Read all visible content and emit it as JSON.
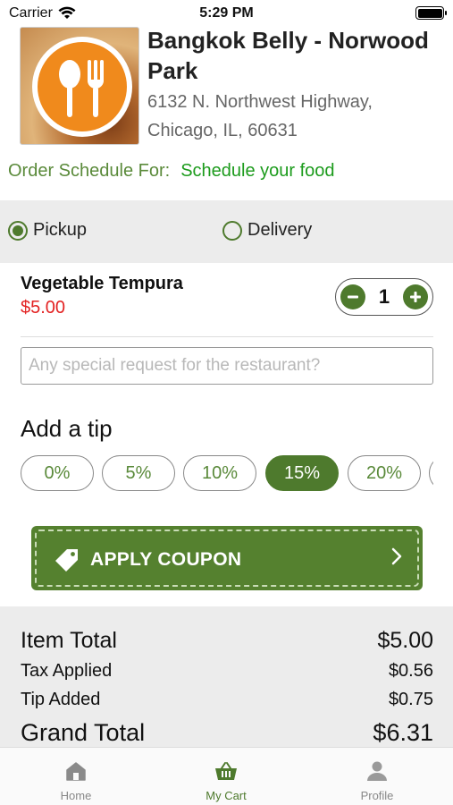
{
  "status_bar": {
    "carrier": "Carrier",
    "time": "5:29 PM"
  },
  "restaurant": {
    "name": "Bangkok Belly - Norwood Park",
    "address_line1": "6132 N. Northwest Highway,",
    "address_line2": "Chicago, IL, 60631"
  },
  "schedule": {
    "label": "Order Schedule For:",
    "link": "Schedule your food"
  },
  "order_mode": {
    "pickup": "Pickup",
    "delivery": "Delivery",
    "selected": "pickup"
  },
  "cart_item": {
    "name": "Vegetable Tempura",
    "price": "$5.00",
    "quantity": "1"
  },
  "special_request": {
    "placeholder": "Any special request for the restaurant?",
    "value": ""
  },
  "tip": {
    "title": "Add a tip",
    "options": [
      "0%",
      "5%",
      "10%",
      "15%",
      "20%"
    ],
    "selected": "15%"
  },
  "coupon": {
    "label": "APPLY COUPON"
  },
  "totals": {
    "item_total_label": "Item Total",
    "item_total": "$5.00",
    "tax_label": "Tax Applied",
    "tax": "$0.56",
    "tip_label": "Tip Added",
    "tip": "$0.75",
    "grand_label": "Grand Total",
    "grand": "$6.31"
  },
  "tabbar": {
    "home": "Home",
    "cart": "My Cart",
    "profile": "Profile",
    "active": "cart"
  },
  "colors": {
    "accent": "#4e7a2d",
    "price": "#e32222",
    "link": "#1c9b1c",
    "logo_orange": "#f08a1c"
  },
  "icons": [
    "wifi-icon",
    "battery-icon",
    "spoon-fork-logo",
    "minus-icon",
    "plus-icon",
    "tag-icon",
    "chevron-right-icon",
    "home-icon",
    "basket-icon",
    "person-icon"
  ]
}
